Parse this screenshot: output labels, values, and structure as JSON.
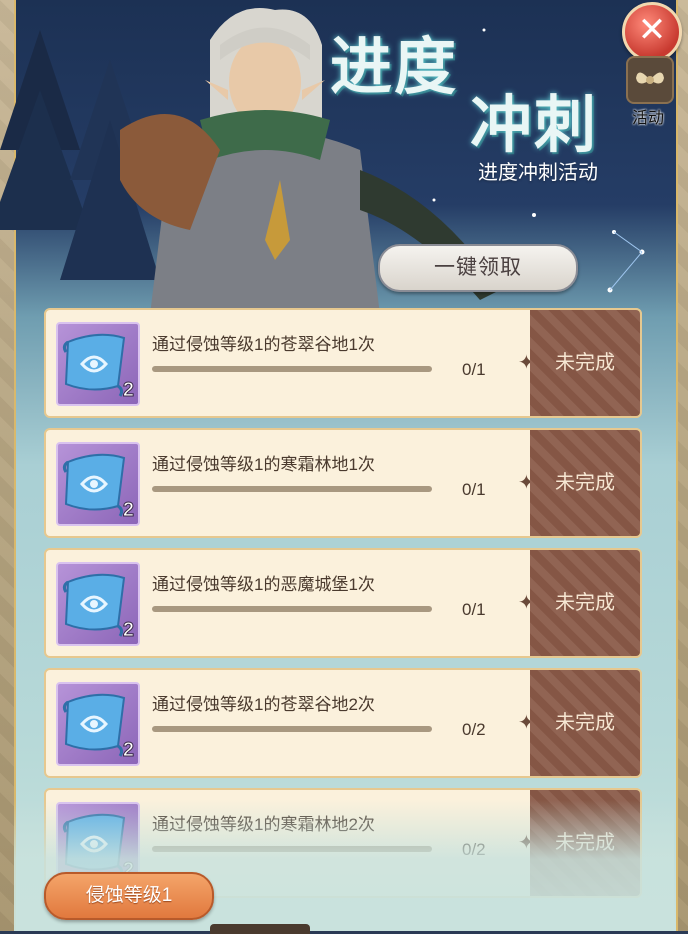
{
  "header": {
    "title_line1": "进度",
    "title_line2": "冲刺",
    "subtitle": "进度冲刺活动"
  },
  "top_right": {
    "close_icon": "close-icon",
    "activity_label": "活动"
  },
  "claim_all_label": "一键领取",
  "tasks": [
    {
      "text": "通过侵蚀等级1的苍翠谷地1次",
      "progress": "0/1",
      "fraction": 0,
      "reward_count": "2",
      "status": "未完成"
    },
    {
      "text": "通过侵蚀等级1的寒霜林地1次",
      "progress": "0/1",
      "fraction": 0,
      "reward_count": "2",
      "status": "未完成"
    },
    {
      "text": "通过侵蚀等级1的恶魔城堡1次",
      "progress": "0/1",
      "fraction": 0,
      "reward_count": "2",
      "status": "未完成"
    },
    {
      "text": "通过侵蚀等级1的苍翠谷地2次",
      "progress": "0/2",
      "fraction": 0,
      "reward_count": "2",
      "status": "未完成"
    },
    {
      "text": "通过侵蚀等级1的寒霜林地2次",
      "progress": "0/2",
      "fraction": 0,
      "reward_count": "2",
      "status": "未完成"
    }
  ],
  "filter_label": "侵蚀等级1",
  "colors": {
    "status_incomplete": "#8a5a48",
    "filter_button": "#e98848",
    "card_bg": "#fbf1dc"
  }
}
